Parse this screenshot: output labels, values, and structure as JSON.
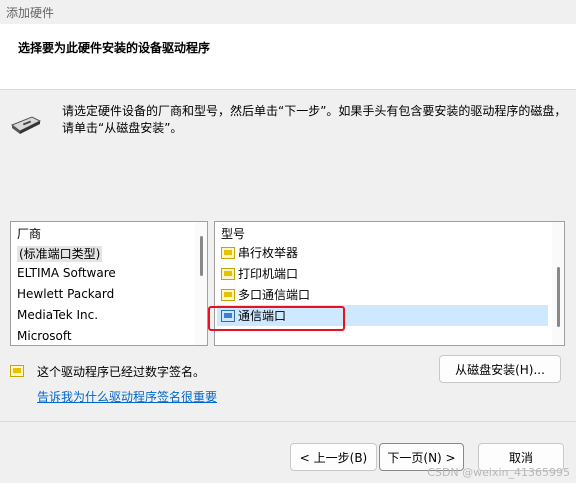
{
  "window": {
    "title": "添加硬件"
  },
  "header": {
    "heading": "选择要为此硬件安装的设备驱动程序"
  },
  "instructions": {
    "icon": "hardware-device-icon",
    "text": "请选定硬件设备的厂商和型号，然后单击“下一步”。如果手头有包含要安装的驱动程序的磁盘，请单击“从磁盘安装”。"
  },
  "manufacturer_list": {
    "header": "厂商",
    "items": [
      "(标准端口类型)",
      "ELTIMA Software",
      "Hewlett Packard",
      "MediaTek Inc.",
      "Microsoft"
    ],
    "selected": "(标准端口类型)"
  },
  "model_list": {
    "header": "型号",
    "items": [
      "串行枚举器",
      "打印机端口",
      "多口通信端口",
      "通信端口"
    ],
    "selected": "通信端口"
  },
  "signature": {
    "text": "这个驱动程序已经过数字签名。",
    "link": "告诉我为什么驱动程序签名很重要"
  },
  "buttons": {
    "have_disk": "从磁盘安装(H)...",
    "back": "< 上一步(B)",
    "next": "下一页(N) >",
    "cancel": "取消"
  },
  "watermark": "CSDN @weixin_41365995",
  "colors": {
    "link": "#0066cc",
    "highlight_border": "#e81123",
    "selection": "#cde8ff"
  }
}
